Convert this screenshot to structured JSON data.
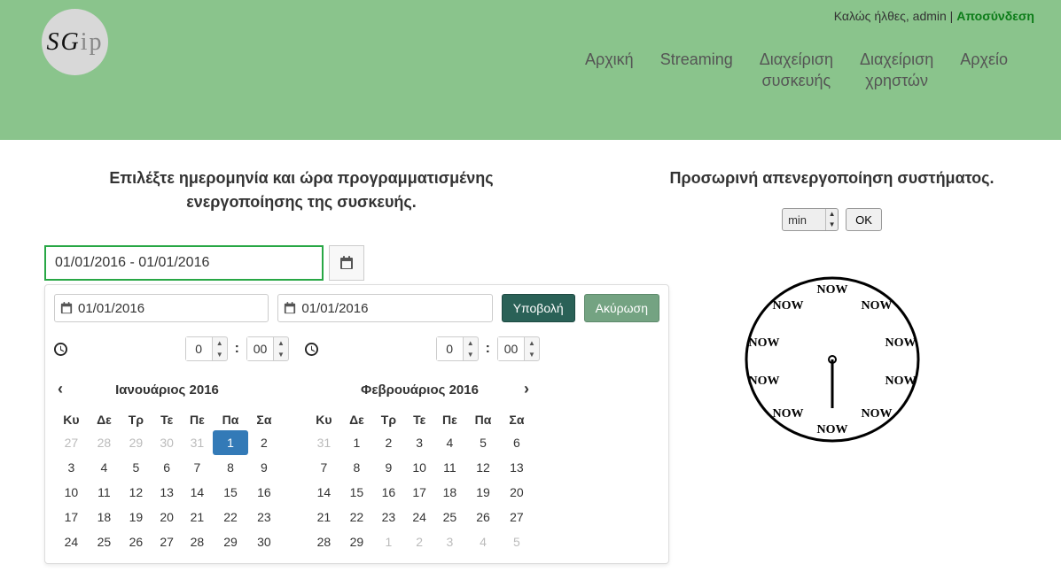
{
  "user_bar": {
    "welcome": "Καλώς ήλθες, admin | ",
    "logout": "Αποσύνδεση"
  },
  "logo": {
    "s": "S",
    "g": "G",
    "ip": "ip"
  },
  "nav": {
    "home": "Αρχική",
    "streaming": "Streaming",
    "device_mgmt_l1": "Διαχείριση",
    "device_mgmt_l2": "συσκευής",
    "user_mgmt_l1": "Διαχείριση",
    "user_mgmt_l2": "χρηστών",
    "archive": "Αρχείο"
  },
  "left": {
    "title_l1": "Επιλέξτε ημερομηνία και ώρα προγραμματισμένης",
    "title_l2": "ενεργοποίησης της συσκευής.",
    "date_range_value": "01/01/2016 - 01/01/2016",
    "start_date": "01/01/2016",
    "end_date": "01/01/2016",
    "submit": "Υποβολή",
    "cancel": "Ακύρωση",
    "start_hour": "0",
    "start_minute": "00",
    "end_hour": "0",
    "end_minute": "00",
    "colon": ":"
  },
  "calendar1": {
    "title": "Ιανουάριος 2016",
    "dow": [
      "Κυ",
      "Δε",
      "Τρ",
      "Τε",
      "Πε",
      "Πα",
      "Σα"
    ],
    "rows": [
      [
        {
          "d": "27",
          "o": true
        },
        {
          "d": "28",
          "o": true
        },
        {
          "d": "29",
          "o": true
        },
        {
          "d": "30",
          "o": true
        },
        {
          "d": "31",
          "o": true
        },
        {
          "d": "1",
          "sel": true
        },
        {
          "d": "2"
        }
      ],
      [
        {
          "d": "3"
        },
        {
          "d": "4"
        },
        {
          "d": "5"
        },
        {
          "d": "6"
        },
        {
          "d": "7"
        },
        {
          "d": "8"
        },
        {
          "d": "9"
        }
      ],
      [
        {
          "d": "10"
        },
        {
          "d": "11"
        },
        {
          "d": "12"
        },
        {
          "d": "13"
        },
        {
          "d": "14"
        },
        {
          "d": "15"
        },
        {
          "d": "16"
        }
      ],
      [
        {
          "d": "17"
        },
        {
          "d": "18"
        },
        {
          "d": "19"
        },
        {
          "d": "20"
        },
        {
          "d": "21"
        },
        {
          "d": "22"
        },
        {
          "d": "23"
        }
      ],
      [
        {
          "d": "24"
        },
        {
          "d": "25"
        },
        {
          "d": "26"
        },
        {
          "d": "27"
        },
        {
          "d": "28"
        },
        {
          "d": "29"
        },
        {
          "d": "30"
        }
      ]
    ]
  },
  "calendar2": {
    "title": "Φεβρουάριος 2016",
    "dow": [
      "Κυ",
      "Δε",
      "Τρ",
      "Τε",
      "Πε",
      "Πα",
      "Σα"
    ],
    "rows": [
      [
        {
          "d": "31",
          "o": true
        },
        {
          "d": "1"
        },
        {
          "d": "2"
        },
        {
          "d": "3"
        },
        {
          "d": "4"
        },
        {
          "d": "5"
        },
        {
          "d": "6"
        }
      ],
      [
        {
          "d": "7"
        },
        {
          "d": "8"
        },
        {
          "d": "9"
        },
        {
          "d": "10"
        },
        {
          "d": "11"
        },
        {
          "d": "12"
        },
        {
          "d": "13"
        }
      ],
      [
        {
          "d": "14"
        },
        {
          "d": "15"
        },
        {
          "d": "16"
        },
        {
          "d": "17"
        },
        {
          "d": "18"
        },
        {
          "d": "19"
        },
        {
          "d": "20"
        }
      ],
      [
        {
          "d": "21"
        },
        {
          "d": "22"
        },
        {
          "d": "23"
        },
        {
          "d": "24"
        },
        {
          "d": "25"
        },
        {
          "d": "26"
        },
        {
          "d": "27"
        }
      ],
      [
        {
          "d": "28"
        },
        {
          "d": "29"
        },
        {
          "d": "1",
          "o": true
        },
        {
          "d": "2",
          "o": true
        },
        {
          "d": "3",
          "o": true
        },
        {
          "d": "4",
          "o": true
        },
        {
          "d": "5",
          "o": true
        }
      ]
    ]
  },
  "right": {
    "title": "Προσωρινή απενεργοποίηση συστήματος.",
    "unit": "min",
    "ok": "OK"
  },
  "now_label": "NOW"
}
